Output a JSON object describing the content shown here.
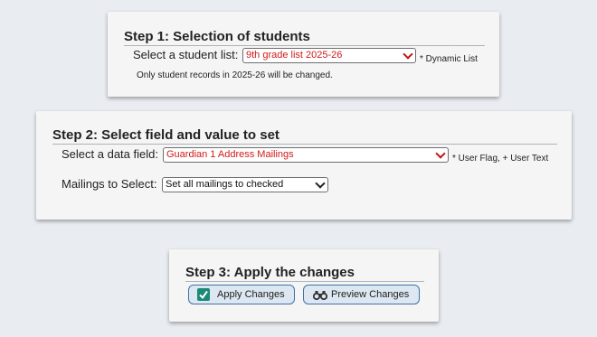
{
  "step1": {
    "title": "Step 1: Selection of students",
    "student_list_label": "Select a student list:",
    "student_list_value": "9th grade list 2025-26",
    "dynamic_note": "* Dynamic List",
    "records_note": "Only student records in 2025-26 will be changed."
  },
  "step2": {
    "title": "Step 2: Select field and value to set",
    "data_field_label": "Select a data field:",
    "data_field_value": "Guardian 1 Address Mailings",
    "field_note": "* User Flag, + User Text",
    "mailings_label": "Mailings to Select:",
    "mailings_value": "Set all mailings to checked"
  },
  "step3": {
    "title": "Step 3: Apply the changes",
    "apply_label": "Apply Changes",
    "preview_label": "Preview Changes"
  },
  "colors": {
    "background": "#e9ecf0",
    "card": "#f5f5f5",
    "select_red_text": "#d01a1a",
    "button_border": "#3f72a8",
    "button_fill": "#dde7f1",
    "checkbox_green": "#1c8a78"
  },
  "icons": {
    "apply": "check-box-icon",
    "preview": "binoculars-icon"
  }
}
